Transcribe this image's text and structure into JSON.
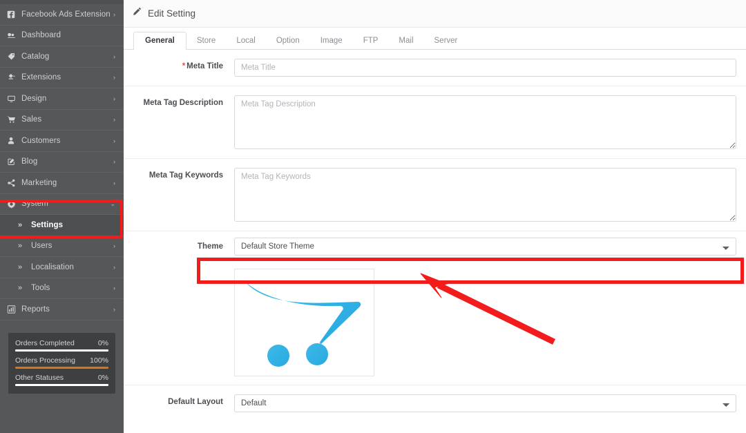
{
  "sidebar": {
    "items": [
      {
        "label": "Facebook Ads Extension",
        "icon": "facebook-icon",
        "caret": "›",
        "level": "top"
      },
      {
        "label": "Dashboard",
        "icon": "dashboard-icon",
        "caret": "",
        "level": "top"
      },
      {
        "label": "Catalog",
        "icon": "tag-icon",
        "caret": "›",
        "level": "top"
      },
      {
        "label": "Extensions",
        "icon": "puzzle-icon",
        "caret": "›",
        "level": "top"
      },
      {
        "label": "Design",
        "icon": "monitor-icon",
        "caret": "›",
        "level": "top"
      },
      {
        "label": "Sales",
        "icon": "cart-icon",
        "caret": "›",
        "level": "top"
      },
      {
        "label": "Customers",
        "icon": "user-icon",
        "caret": "›",
        "level": "top"
      },
      {
        "label": "Blog",
        "icon": "pencil-square-icon",
        "caret": "›",
        "level": "top"
      },
      {
        "label": "Marketing",
        "icon": "share-icon",
        "caret": "›",
        "level": "top"
      },
      {
        "label": "System",
        "icon": "gear-icon",
        "caret": "⌄",
        "level": "top",
        "expanded": true
      },
      {
        "label": "Settings",
        "icon": "»",
        "caret": "",
        "level": "sub",
        "active": true
      },
      {
        "label": "Users",
        "icon": "»",
        "caret": "›",
        "level": "sub2"
      },
      {
        "label": "Localisation",
        "icon": "»",
        "caret": "›",
        "level": "sub2"
      },
      {
        "label": "Tools",
        "icon": "»",
        "caret": "›",
        "level": "sub2"
      },
      {
        "label": "Reports",
        "icon": "bar-chart-icon",
        "caret": "›",
        "level": "top"
      }
    ],
    "stats": [
      {
        "label": "Orders Completed",
        "value": "0%",
        "percent": 100,
        "color": "#ffffff"
      },
      {
        "label": "Orders Processing",
        "value": "100%",
        "percent": 100,
        "color": "#d9741b"
      },
      {
        "label": "Other Statuses",
        "value": "0%",
        "percent": 100,
        "color": "#ffffff"
      }
    ]
  },
  "page": {
    "title": "Edit Setting",
    "pencil_icon": "pencil-icon"
  },
  "tabs": [
    {
      "label": "General",
      "active": true
    },
    {
      "label": "Store",
      "active": false
    },
    {
      "label": "Local",
      "active": false
    },
    {
      "label": "Option",
      "active": false
    },
    {
      "label": "Image",
      "active": false
    },
    {
      "label": "FTP",
      "active": false
    },
    {
      "label": "Mail",
      "active": false
    },
    {
      "label": "Server",
      "active": false
    }
  ],
  "form": {
    "meta_title": {
      "label": "Meta Title",
      "required_marker": "*",
      "value": "",
      "placeholder": "Meta Title"
    },
    "meta_description": {
      "label": "Meta Tag Description",
      "value": "",
      "placeholder": "Meta Tag Description"
    },
    "meta_keywords": {
      "label": "Meta Tag Keywords",
      "value": "",
      "placeholder": "Meta Tag Keywords"
    },
    "theme": {
      "label": "Theme",
      "selected": "Default Store Theme",
      "options": [
        "Default Store Theme"
      ]
    },
    "theme_preview": {
      "alt": "opencart-logo-preview"
    },
    "default_layout": {
      "label": "Default Layout",
      "selected": "Default",
      "options": [
        "Default"
      ]
    }
  },
  "annotations": {
    "highlight_color": "#f21c1c",
    "sidebar_box": "system-settings-highlight",
    "theme_box": "theme-select-highlight",
    "arrow": "arrow-pointing-to-theme-select"
  }
}
